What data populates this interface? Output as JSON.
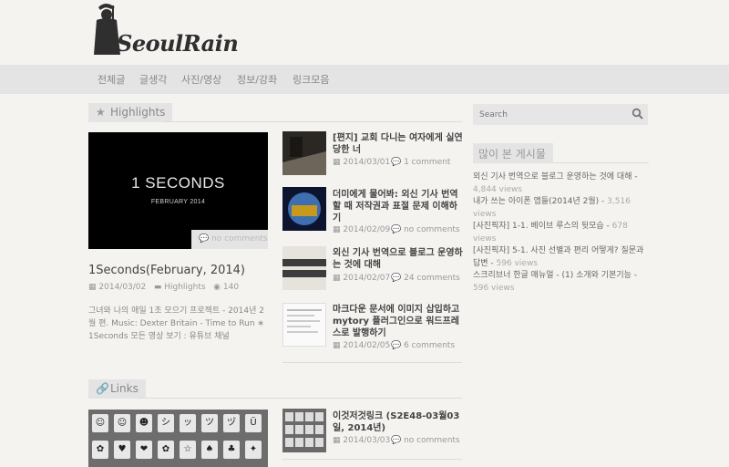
{
  "site": {
    "logo_text": "SeoulRain"
  },
  "nav": [
    "전체글",
    "글생각",
    "사진/영상",
    "정보/강좌",
    "링크모음"
  ],
  "highlights": {
    "heading": "Highlights",
    "featured": {
      "image_title": "1 SECONDS",
      "image_subtitle": "FEBRUARY 2014",
      "comments": "no comments",
      "title": "1Seconds(February, 2014)",
      "date": "2014/03/02",
      "category": "Highlights",
      "views": "140",
      "description": "그녀와 나의 매일 1초 모으기 프로젝트 - 2014년 2월 편. Music: Dexter Britain - Time to Run ∗ 1Seconds 모든 영상 보기 : 유튜브 채널"
    },
    "posts": [
      {
        "title": "[편지] 교회 다니는 여자에게 실연당한 너",
        "date": "2014/03/01",
        "comments": "1 comment"
      },
      {
        "title": "더미에게 물어봐: 외신 기사 번역할 때 저작권과 표절 문제 이해하기",
        "date": "2014/02/09",
        "comments": "no comments"
      },
      {
        "title": "외신 기사 번역으로 블로그 운영하는 것에 대해",
        "date": "2014/02/07",
        "comments": "24 comments"
      },
      {
        "title": "마크다운 문서에 이미지 삽입하고 mytory 플러그인으로 워드프레스로 발행하기",
        "date": "2014/02/05",
        "comments": "6 comments"
      }
    ]
  },
  "links": {
    "heading": "Links",
    "posts": [
      {
        "title": "이것저것링크 (S2E48-03월03일, 2014년)",
        "date": "2014/03/03",
        "comments": "no comments"
      }
    ],
    "image_keys": [
      "☺",
      "☺",
      "☻",
      "シ",
      "ッ",
      "ツ",
      "ヅ",
      "Ü",
      "✿",
      "♥",
      "❤",
      "✿",
      "☆",
      "♠",
      "♣",
      "✦"
    ]
  },
  "sidebar": {
    "search_placeholder": "Search",
    "popular_heading": "많이 본 게시물",
    "popular": [
      {
        "title": "외신 기사 번역으로 블로그 운영하는 것에 대해",
        "views": "4,844 views"
      },
      {
        "title": "내가 쓰는 아이폰 앱들(2014년 2월)",
        "views": "3,516 views"
      },
      {
        "title": "[사진픽자] 1-1. 베이브 루스의 뒷모습",
        "views": "678 views"
      },
      {
        "title": "[사진픽자] 5-1. 사진 선별과 편리 어떻게? 질문과 답변",
        "views": "596 views"
      },
      {
        "title": "스크리브너 한글 매뉴얼 - (1) 소개와 기본기능",
        "views": "596 views"
      }
    ]
  },
  "colors": {
    "background": "#f4f3f0",
    "nav_bg": "#e4e4e4",
    "accent_text": "#444444"
  }
}
